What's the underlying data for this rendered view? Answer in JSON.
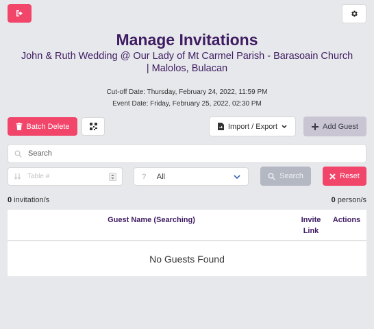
{
  "header": {
    "logout_icon": "sign-out-icon",
    "settings_icon": "gear-icon"
  },
  "page": {
    "title": "Manage Invitations",
    "subtitle": "John & Ruth Wedding @ Our Lady of Mt Carmel Parish - Barasoain Church | Malolos, Bulacan",
    "cutoff": "Cut-off Date: Thursday, February 24, 2022, 11:59 PM",
    "event": "Event Date: Friday, February 25, 2022, 02:30 PM"
  },
  "toolbar": {
    "batch_delete": "Batch Delete",
    "qr_icon": "qrcode-icon",
    "import_export": "Import / Export",
    "add_guest": "Add Guest"
  },
  "search": {
    "placeholder": "Search",
    "table_placeholder": "Table #",
    "filter_selected": "All",
    "search_button": "Search",
    "reset_button": "Reset"
  },
  "counts": {
    "invitations_value": "0",
    "invitations_label": " invitation/s",
    "persons_value": "0",
    "persons_label": " person/s"
  },
  "table": {
    "columns": [
      "Guest Name (Searching)",
      "Invite Link",
      "Actions"
    ],
    "empty_message": "No Guests Found"
  },
  "colors": {
    "primary": "#f1456a",
    "heading": "#3f1c62",
    "background": "#e6e8eb"
  }
}
